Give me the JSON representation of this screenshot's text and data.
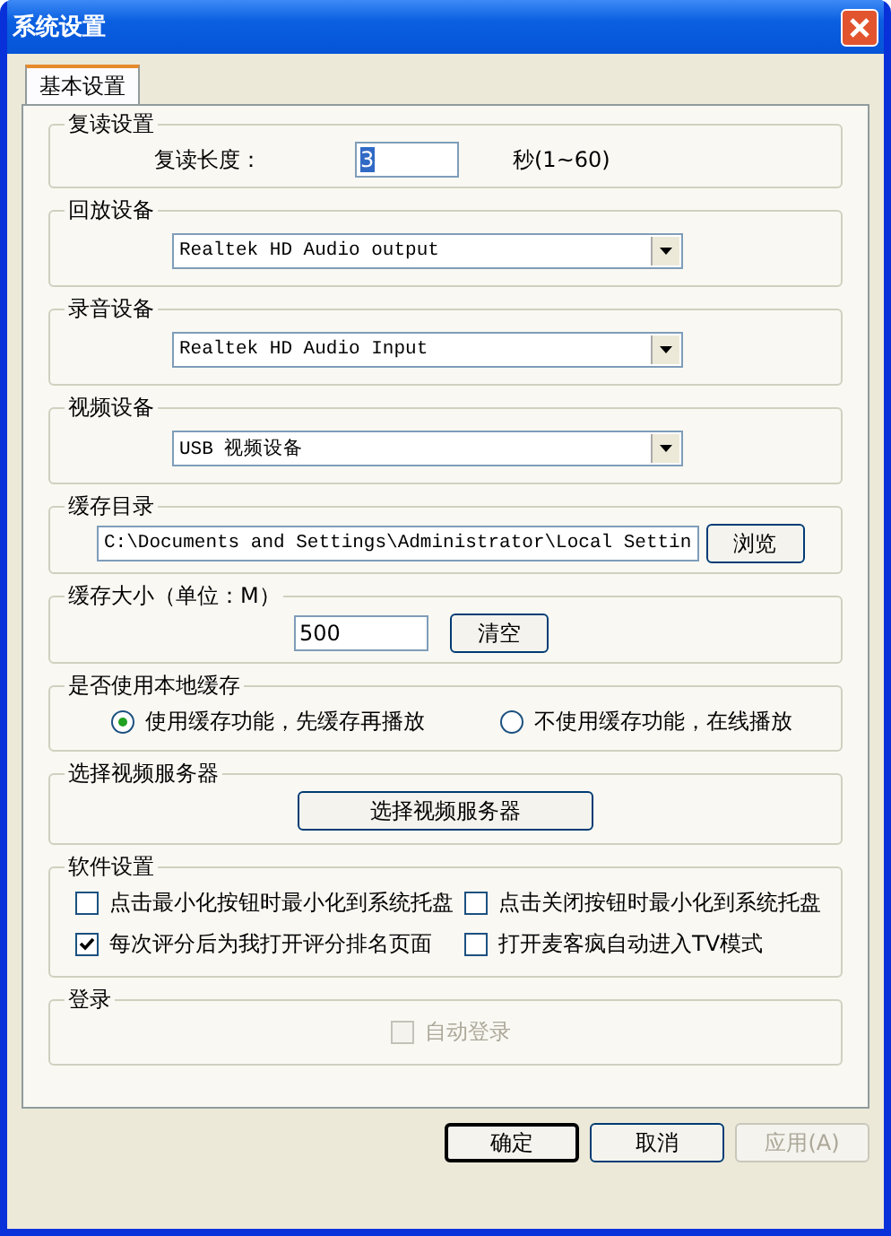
{
  "window": {
    "title": "系统设置"
  },
  "tabs": [
    {
      "label": "基本设置",
      "selected": true
    }
  ],
  "groups": [
    {
      "kind": "field",
      "title": "复读设置",
      "label": "复读长度：",
      "value": "3",
      "unit": "秒(1~60)"
    },
    {
      "kind": "dropdown",
      "title": "回放设备",
      "value": "Realtek HD Audio output"
    },
    {
      "kind": "dropdown",
      "title": "录音设备",
      "value": "Realtek HD Audio Input"
    },
    {
      "kind": "dropdown",
      "title": "视频设备",
      "value": "USB 视频设备"
    },
    {
      "kind": "path",
      "title": "缓存目录",
      "value": "C:\\Documents and Settings\\Administrator\\Local Settin",
      "button": "浏览"
    },
    {
      "kind": "size",
      "title": "缓存大小（单位：M）",
      "value": "500",
      "button": "清空"
    },
    {
      "kind": "radio",
      "title": "是否使用本地缓存",
      "options": [
        {
          "label": "使用缓存功能，先缓存再播放",
          "selected": true
        },
        {
          "label": "不使用缓存功能，在线播放",
          "selected": false
        }
      ]
    },
    {
      "kind": "button",
      "title": "选择视频服务器",
      "button": "选择视频服务器"
    },
    {
      "kind": "checks",
      "title": "软件设置",
      "options": [
        {
          "label": "点击最小化按钮时最小化到系统托盘",
          "checked": false,
          "disabled": false
        },
        {
          "label": "点击关闭按钮时最小化到系统托盘",
          "checked": false,
          "disabled": false
        },
        {
          "label": "每次评分后为我打开评分排名页面",
          "checked": true,
          "disabled": false
        },
        {
          "label": "打开麦客疯自动进入TV模式",
          "checked": false,
          "disabled": false
        }
      ]
    },
    {
      "kind": "login",
      "title": "登录",
      "options": [
        {
          "label": "自动登录",
          "checked": false,
          "disabled": true
        }
      ]
    }
  ],
  "buttons": [
    {
      "label": "确定",
      "default": true,
      "disabled": false
    },
    {
      "label": "取消",
      "default": false,
      "disabled": false
    },
    {
      "label": "应用(A)",
      "default": false,
      "disabled": true
    }
  ]
}
